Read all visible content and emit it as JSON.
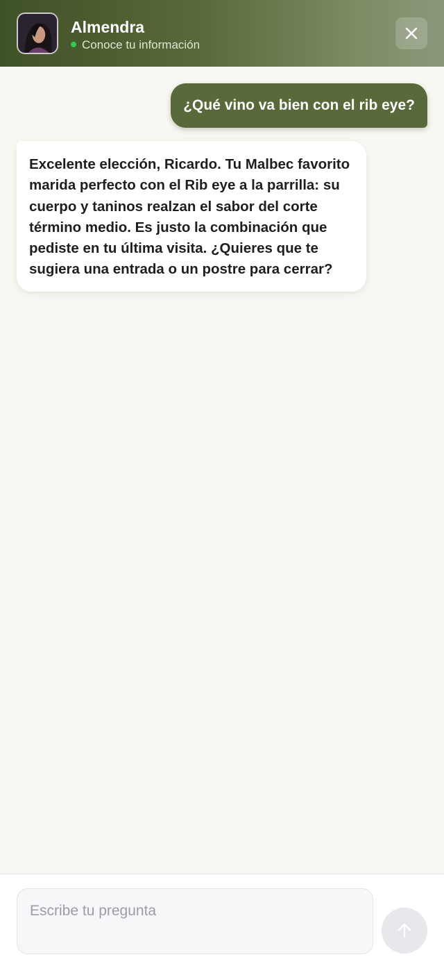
{
  "header": {
    "agent_name": "Almendra",
    "status_text": "Conoce tu información",
    "status_color": "#2ecc50",
    "close_icon": "close-icon",
    "avatar_icon": "avatar"
  },
  "messages": [
    {
      "role": "user",
      "text": "¿Qué vino va bien con el rib eye?"
    },
    {
      "role": "assistant",
      "text": "Excelente elección, Ricardo. Tu Malbec favorito marida perfecto con el Rib eye a la parrilla: su cuerpo y taninos realzan el sabor del corte término medio. Es justo la combinación que pediste en tu última visita. ¿Quieres que te sugiera una entrada o un postre para cerrar?"
    }
  ],
  "composer": {
    "placeholder": "Escribe tu pregunta",
    "value": "",
    "send_icon": "arrow-up-icon"
  },
  "colors": {
    "brand": "#58693a",
    "background": "#f8f8f2"
  }
}
